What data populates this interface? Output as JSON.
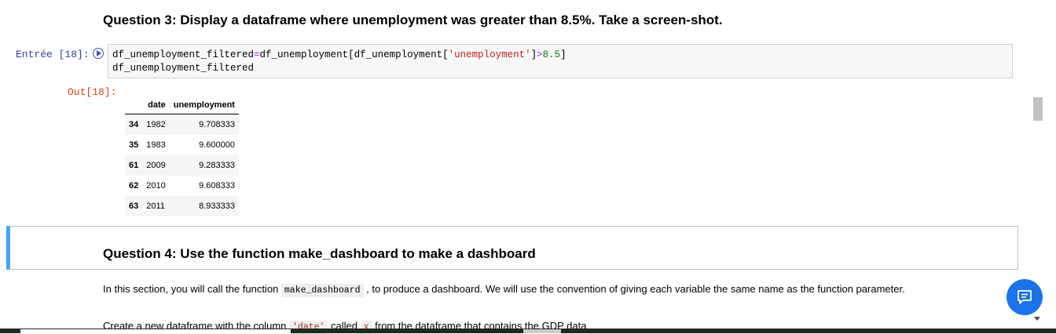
{
  "q3": {
    "heading": "Question 3: Display a dataframe where unemployment was greater than 8.5%. Take a screen-shot."
  },
  "input_cell": {
    "prompt": "Entrée [18]:",
    "code": {
      "l1_a": "df_unemployment_filtered",
      "l1_eq": "=",
      "l1_b": "df_unemployment[df_unemployment[",
      "l1_str": "'unemployment'",
      "l1_c": "]",
      "l1_gt": ">",
      "l1_num": "8.5",
      "l1_d": "]",
      "l2": "df_unemployment_filtered"
    }
  },
  "output_cell": {
    "prompt": "Out[18]:",
    "columns": [
      "date",
      "unemployment"
    ],
    "rows": [
      {
        "index": "34",
        "date": "1982",
        "unemployment": "9.708333"
      },
      {
        "index": "35",
        "date": "1983",
        "unemployment": "9.600000"
      },
      {
        "index": "61",
        "date": "2009",
        "unemployment": "9.283333"
      },
      {
        "index": "62",
        "date": "2010",
        "unemployment": "9.608333"
      },
      {
        "index": "63",
        "date": "2011",
        "unemployment": "8.933333"
      }
    ]
  },
  "q4": {
    "heading": "Question 4: Use the function make_dashboard to make a dashboard",
    "para1_a": "In this section, you will call the function ",
    "para1_code": "make_dashboard",
    "para1_b": " , to produce a dashboard. We will use the convention of giving each variable the same name as the function parameter.",
    "para2_a": "Create a new dataframe with the column ",
    "para2_code1": "'date'",
    "para2_b": " called ",
    "para2_code2": "x",
    "para2_c": " from the dataframe that contains the GDP data."
  },
  "icons": {
    "run": "play-circle-icon",
    "chat": "chat-icon"
  },
  "colors": {
    "in_prompt": "#303f9f",
    "out_prompt": "#d84315",
    "selected_cell_bar": "#42a5f5",
    "chat_fab": "#1a73e8"
  }
}
